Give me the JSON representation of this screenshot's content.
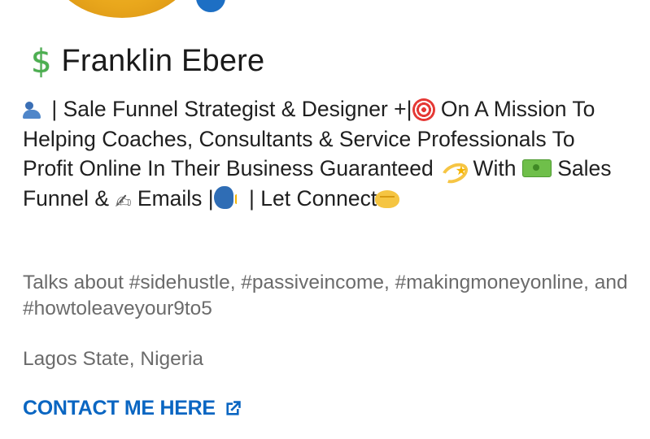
{
  "profile": {
    "name_emoji": "$",
    "name": "Franklin Ebere",
    "headline": {
      "part1": " | Sale Funnel Strategist & Designer +|",
      "part2": " On A Mission To Helping Coaches, Consultants & Service Professionals To Profit Online In Their Business Guaranteed ",
      "part3": " With ",
      "part4": " Sales Funnel & ",
      "part5": " Emails |",
      "part6": " | Let Connect"
    },
    "talks_about": "Talks about #sidehustle, #passiveincome, #makingmoneyonline, and #howtoleaveyour9to5",
    "location": "Lagos State, Nigeria",
    "contact_label": "CONTACT ME HERE"
  },
  "icons": {
    "headline_lead": "people-icon",
    "target": "direct-hit-icon",
    "sparkle": "dizzy-sparkle-icon",
    "money": "money-bill-icon",
    "pen": "writing-hand-icon",
    "speak": "speaking-head-icon",
    "handshake": "handshake-icon",
    "external": "external-link-icon"
  },
  "colors": {
    "link": "#0a66c2",
    "name_text": "#1a1a1a",
    "muted_text": "#6b6b6b",
    "dollar": "#4caf50"
  }
}
